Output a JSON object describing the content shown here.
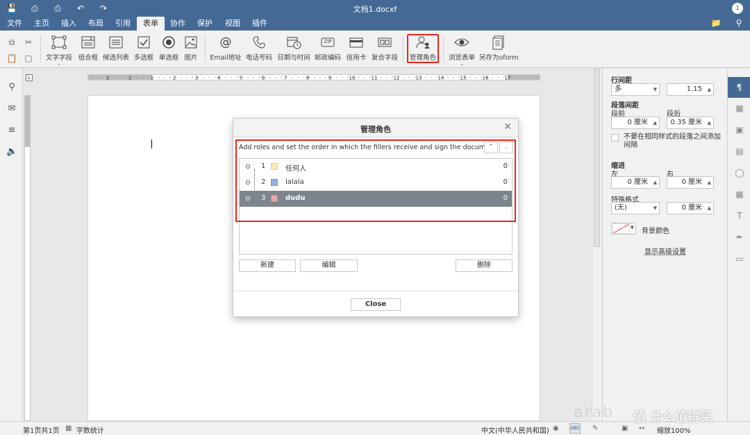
{
  "window": {
    "title": "文档1.docxf",
    "avatar": "1"
  },
  "menu": {
    "tabs": [
      "文件",
      "主页",
      "插入",
      "布局",
      "引用",
      "表单",
      "协作",
      "保护",
      "视图",
      "插件"
    ],
    "active_tab": "表单"
  },
  "toolbar": {
    "buttons": {
      "text_field": "文字字段",
      "combo_box": "组合框",
      "dropdown_list": "候选列表",
      "checkbox": "多选框",
      "radio": "单选框",
      "image": "图片",
      "email": "Email地址",
      "phone": "电话号码",
      "datetime": "日期与时间",
      "zip": "邮政编码",
      "credit_card": "信用卡",
      "complex_field": "复合字段",
      "manage_roles": "管理角色",
      "view_form": "浏览表单",
      "save_oform": "另存为oform"
    },
    "zip_badge": "ZIP"
  },
  "ruler": {
    "h_ticks": [
      "2",
      "1",
      "1",
      "2",
      "3",
      "4",
      "5",
      "6",
      "7",
      "8",
      "9",
      "10",
      "11",
      "12",
      "13",
      "14",
      "15",
      "16",
      "17"
    ]
  },
  "right_panel": {
    "line_spacing_label": "行间距",
    "line_spacing_type": "多",
    "line_spacing_value": "1.15",
    "paragraph_spacing_label": "段落间距",
    "before_label": "段前",
    "after_label": "段后",
    "before_value": "0 厘米",
    "after_value": "0.35 厘米",
    "no_space_same_style": "不要在相同样式的段落之间添加间隔",
    "indent_label": "缩进",
    "left_label": "左",
    "right_label": "右",
    "left_value": "0 厘米",
    "right_value": "0 厘米",
    "special_label": "特殊格式",
    "special_type": "(无)",
    "special_value": "0 厘米",
    "background_color_label": "背景颜色",
    "advanced_settings": "显示高级设置"
  },
  "dialog": {
    "title": "管理角色",
    "description": "Add roles and set the order in which the fillers receive and sign the document",
    "roles": [
      {
        "num": "1",
        "name": "任何人",
        "count": "0",
        "color": "#fde9b3"
      },
      {
        "num": "2",
        "name": "lalala",
        "count": "0",
        "color": "#8db4e8"
      },
      {
        "num": "3",
        "name": "dudu",
        "count": "0",
        "color": "#e8a8a8"
      }
    ],
    "selected_index": 2,
    "new_button": "新建",
    "edit_button": "编辑",
    "delete_button": "删除",
    "close_button": "Close"
  },
  "status": {
    "page": "第1页共1页",
    "word_count": "字数统计",
    "language": "中文(中华人民共和国)",
    "zoom": "缩放100%"
  },
  "watermark": "值 什么值得买"
}
